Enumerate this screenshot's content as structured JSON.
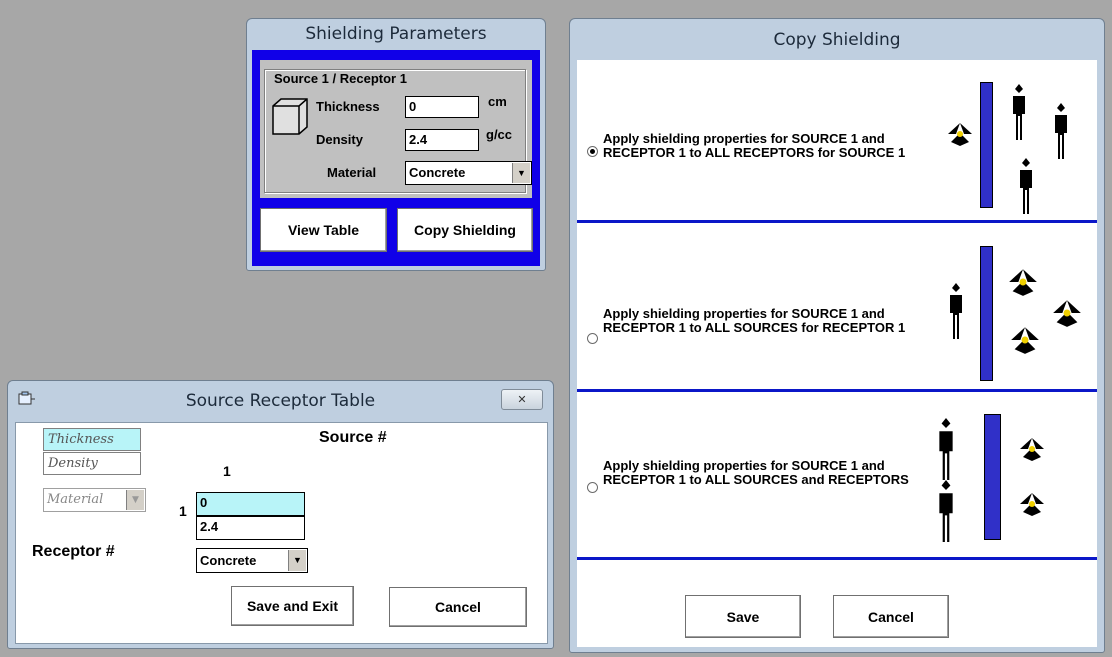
{
  "shielding_parameters": {
    "title": "Shielding Parameters",
    "group_label": "Source 1 / Receptor 1",
    "thickness_label": "Thickness",
    "thickness_value": "0",
    "thickness_unit": "cm",
    "density_label": "Density",
    "density_value": "2.4",
    "density_unit": "g/cc",
    "material_label": "Material",
    "material_value": "Concrete",
    "view_table_button": "View Table",
    "copy_shielding_button": "Copy Shielding"
  },
  "source_receptor_table": {
    "title": "Source Receptor Table",
    "legend": {
      "thickness": "Thickness",
      "density": "Density",
      "material": "Material"
    },
    "source_header": "Source #",
    "receptor_header": "Receptor #",
    "source_index": "1",
    "receptor_index": "1",
    "cell_thickness": "0",
    "cell_density": "2.4",
    "cell_material": "Concrete",
    "save_exit_button": "Save and Exit",
    "cancel_button": "Cancel"
  },
  "copy_shielding": {
    "title": "Copy Shielding",
    "options": [
      {
        "text": "Apply shielding properties for SOURCE 1 and RECEPTOR 1 to ALL RECEPTORS for SOURCE 1",
        "selected": true
      },
      {
        "text": "Apply shielding properties for SOURCE 1 and RECEPTOR 1 to ALL SOURCES for RECEPTOR 1",
        "selected": false
      },
      {
        "text": "Apply shielding properties for SOURCE 1 and RECEPTOR 1 to ALL SOURCES and RECEPTORS",
        "selected": false
      }
    ],
    "save_button": "Save",
    "cancel_button": "Cancel"
  },
  "colors": {
    "desktop": "#a7a7a7",
    "accent_blue": "#1000e8",
    "shield_wall": "#3030c8",
    "highlight_cyan": "#b8f4f8"
  }
}
